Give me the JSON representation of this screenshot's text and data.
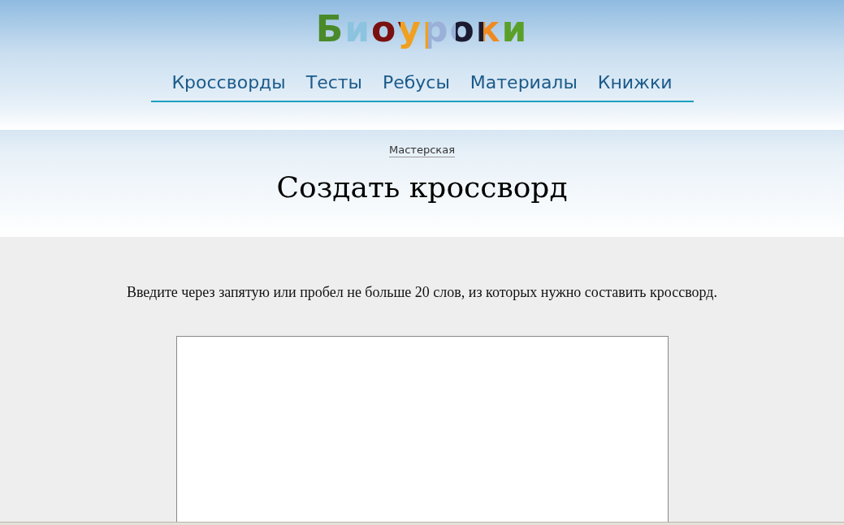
{
  "logo": {
    "text": "Биоуроки"
  },
  "nav": [
    {
      "label": "Кроссворды"
    },
    {
      "label": "Тесты"
    },
    {
      "label": "Ребусы"
    },
    {
      "label": "Материалы"
    },
    {
      "label": "Книжки"
    }
  ],
  "breadcrumb": "Мастерская",
  "title": "Создать кроссворд",
  "instruction": "Введите через запятую или пробел не больше 20 слов, из которых нужно составить кроссворд."
}
